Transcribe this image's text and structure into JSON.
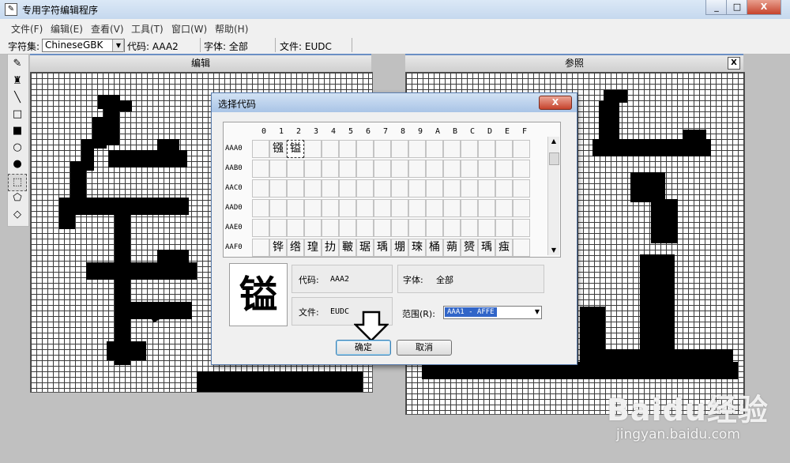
{
  "window": {
    "title": "专用字符编辑程序",
    "minimize": "_",
    "maximize": "□",
    "close": "X"
  },
  "menu": [
    "文件(F)",
    "编辑(E)",
    "查看(V)",
    "工具(T)",
    "窗口(W)",
    "帮助(H)"
  ],
  "charset_bar": {
    "label": "字符集:",
    "charset": "ChineseGBK",
    "code": "代码: AAA2",
    "font": "字体: 全部",
    "file": "文件: EUDC"
  },
  "panes": {
    "edit_title": "编辑",
    "ref_title": "参照",
    "ref_close": "X"
  },
  "dialog": {
    "title": "选择代码",
    "close": "X",
    "columns": [
      "0",
      "1",
      "2",
      "3",
      "4",
      "5",
      "6",
      "7",
      "8",
      "9",
      "A",
      "B",
      "C",
      "D",
      "E",
      "F"
    ],
    "rows": [
      {
        "label": "AAA0",
        "cells": [
          "",
          "镪",
          "镒",
          "",
          "",
          "",
          "",
          "",
          "",
          "",
          "",
          "",
          "",
          "",
          "",
          ""
        ]
      },
      {
        "label": "AAB0",
        "cells": [
          "",
          "",
          "",
          "",
          "",
          "",
          "",
          "",
          "",
          "",
          "",
          "",
          "",
          "",
          "",
          ""
        ]
      },
      {
        "label": "AAC0",
        "cells": [
          "",
          "",
          "",
          "",
          "",
          "",
          "",
          "",
          "",
          "",
          "",
          "",
          "",
          "",
          "",
          ""
        ]
      },
      {
        "label": "AAD0",
        "cells": [
          "",
          "",
          "",
          "",
          "",
          "",
          "",
          "",
          "",
          "",
          "",
          "",
          "",
          "",
          "",
          ""
        ]
      },
      {
        "label": "AAE0",
        "cells": [
          "",
          "",
          "",
          "",
          "",
          "",
          "",
          "",
          "",
          "",
          "",
          "",
          "",
          "",
          "",
          ""
        ]
      },
      {
        "label": "AAF0",
        "cells": [
          "",
          "铧",
          "绺",
          "瑝",
          "扐",
          "皸",
          "琚",
          "瑀",
          "堋",
          "琜",
          "桶",
          "蒴",
          "赟",
          "瑀",
          "痋",
          ""
        ]
      }
    ],
    "preview_char": "镒",
    "code_label": "代码:",
    "code_value": "AAA2",
    "font_label": "字体:",
    "font_value": "全部",
    "file_label": "文件:",
    "file_value": "EUDC",
    "range_label": "范围(R):",
    "range_value": "AAA1 - AFFE",
    "ok": "确定",
    "cancel": "取消"
  },
  "watermark": {
    "brand": "Baidu经验",
    "url": "jingyan.baidu.com"
  }
}
